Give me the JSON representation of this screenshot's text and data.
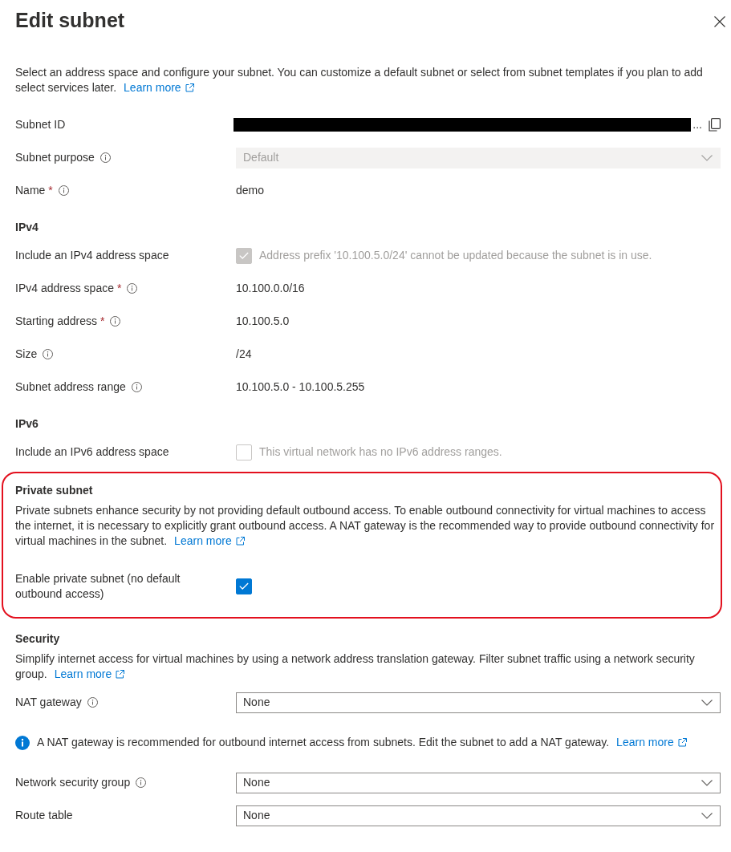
{
  "title": "Edit subnet",
  "intro": {
    "text": "Select an address space and configure your subnet. You can customize a default subnet or select from subnet templates if you plan to add select services later.",
    "link": "Learn more"
  },
  "sections": [
    {
      "highlighted": false,
      "rows": [
        {
          "kind": "redacted",
          "label": "Subnet ID",
          "info": false,
          "value": "..."
        },
        {
          "kind": "dropdown",
          "label": "Subnet purpose",
          "info": true,
          "value": "Default",
          "disabled": true
        },
        {
          "kind": "text",
          "label": "Name",
          "required_mark": "*",
          "info": true,
          "value": "demo"
        }
      ]
    },
    {
      "heading": "IPv4",
      "highlighted": false,
      "rows": [
        {
          "kind": "checkbox",
          "label": "Include an IPv4 address space",
          "info": false,
          "checked": true,
          "disabled": true,
          "text": "Address prefix '10.100.5.0/24' cannot be updated because the subnet is in use."
        },
        {
          "kind": "text",
          "label": "IPv4 address space",
          "required_mark": "*",
          "info": true,
          "value": "10.100.0.0/16"
        },
        {
          "kind": "text",
          "label": "Starting address",
          "required_mark": "*",
          "info": true,
          "value": "10.100.5.0"
        },
        {
          "kind": "text",
          "label": "Size",
          "info": true,
          "value": "/24"
        },
        {
          "kind": "text",
          "label": "Subnet address range",
          "info": true,
          "value": "10.100.5.0 - 10.100.5.255"
        }
      ]
    },
    {
      "heading": "IPv6",
      "highlighted": false,
      "rows": [
        {
          "kind": "checkbox",
          "label": "Include an IPv6 address space",
          "info": false,
          "checked": false,
          "disabled": true,
          "text": "This virtual network has no IPv6 address ranges."
        }
      ]
    },
    {
      "heading": "Private subnet",
      "highlighted": true,
      "description": "Private subnets enhance security by not providing default outbound access. To enable outbound connectivity for virtual machines to access the internet, it is necessary to explicitly grant outbound access. A NAT gateway is the recommended way to provide outbound connectivity for virtual machines in the subnet.",
      "link": "Learn more",
      "rows": [
        {
          "kind": "checkbox",
          "label": "Enable private subnet (no default outbound access)",
          "info": false,
          "checked": true,
          "disabled": false
        }
      ]
    },
    {
      "heading": "Security",
      "highlighted": false,
      "description": "Simplify internet access for virtual machines by using a network address translation gateway. Filter subnet traffic using a network security group.",
      "link": "Learn more",
      "rows": [
        {
          "kind": "dropdown",
          "label": "NAT gateway",
          "info": true,
          "value": "None",
          "disabled": false
        },
        {
          "kind": "notice",
          "text": "A NAT gateway is recommended for outbound internet access from subnets. Edit the subnet to add a NAT gateway.",
          "link": "Learn more"
        },
        {
          "kind": "dropdown",
          "label": "Network security group",
          "info": true,
          "value": "None",
          "disabled": false
        },
        {
          "kind": "dropdown",
          "label": "Route table",
          "info": false,
          "value": "None",
          "disabled": false
        }
      ]
    }
  ]
}
